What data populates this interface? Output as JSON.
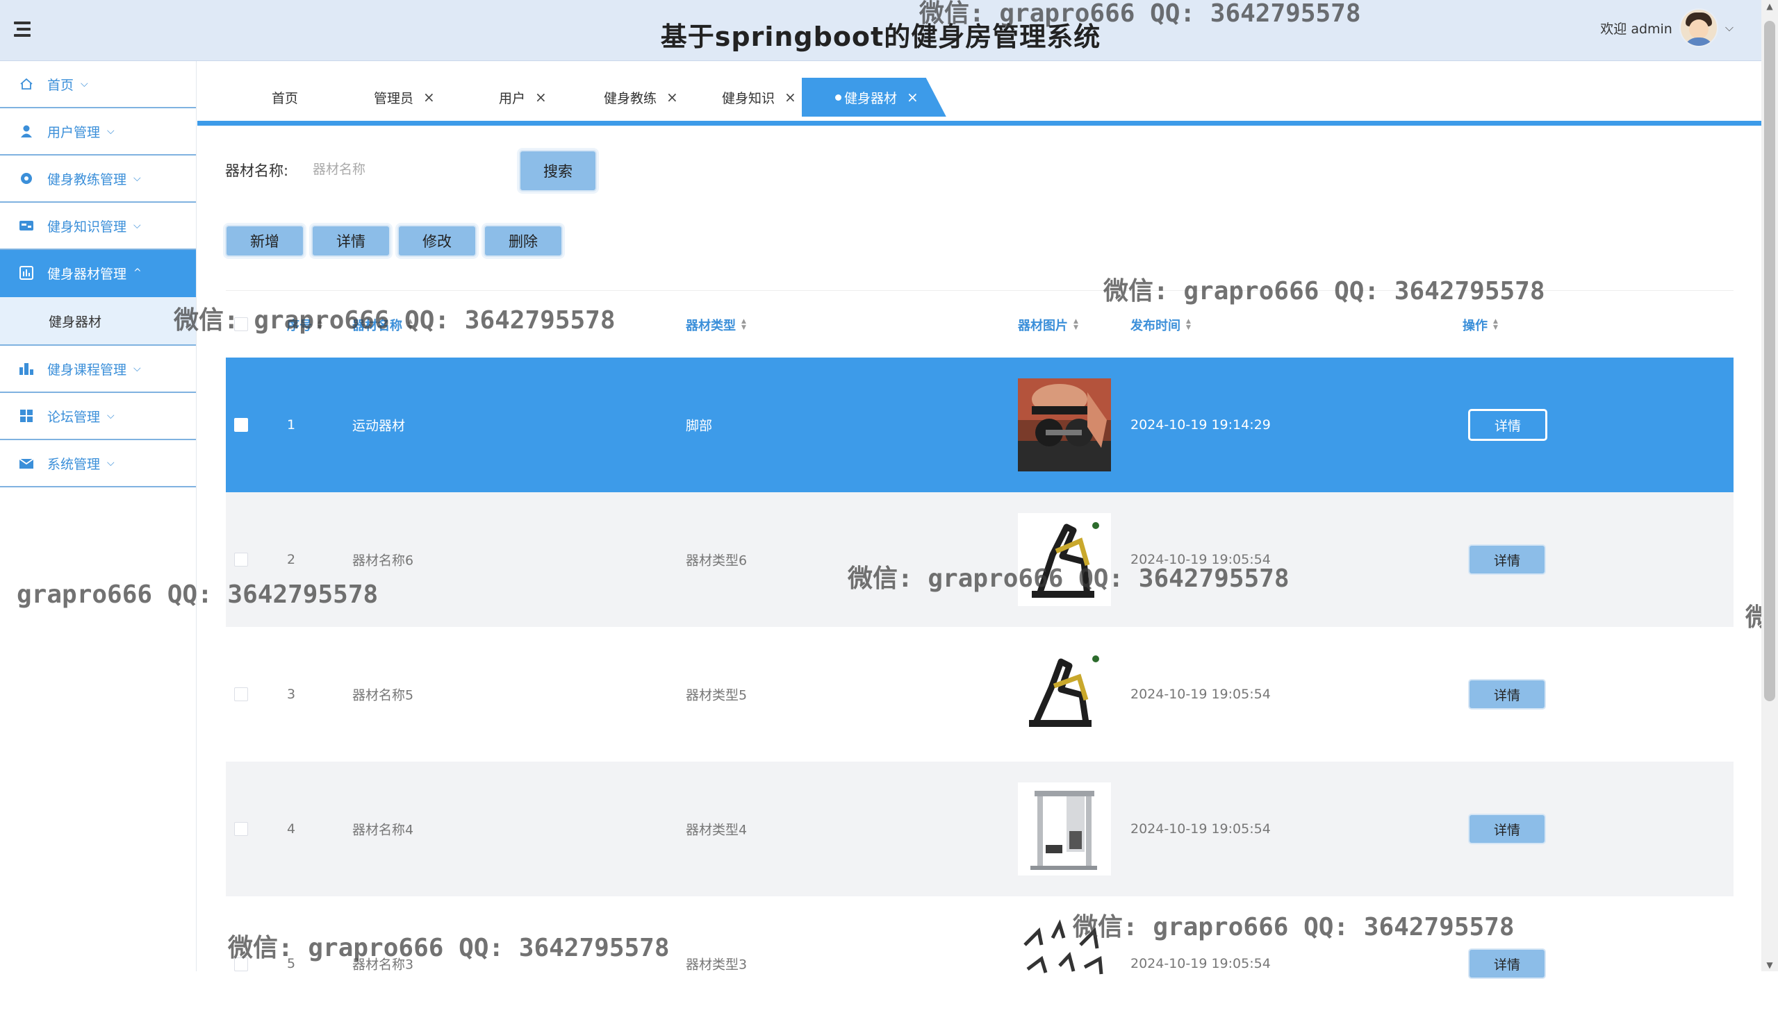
{
  "header": {
    "title": "基于springboot的健身房管理系统",
    "welcome": "欢迎 admin"
  },
  "sidebar": {
    "items": [
      {
        "label": "首页",
        "icon": "home-icon"
      },
      {
        "label": "用户管理",
        "icon": "user-icon"
      },
      {
        "label": "健身教练管理",
        "icon": "coach-icon"
      },
      {
        "label": "健身知识管理",
        "icon": "knowledge-icon"
      },
      {
        "label": "健身器材管理",
        "icon": "equipment-icon",
        "active": true
      },
      {
        "label": "健身课程管理",
        "icon": "course-icon"
      },
      {
        "label": "论坛管理",
        "icon": "forum-icon"
      },
      {
        "label": "系统管理",
        "icon": "system-icon"
      }
    ],
    "sub_item": "健身器材"
  },
  "tabs": [
    {
      "label": "首页"
    },
    {
      "label": "管理员"
    },
    {
      "label": "用户"
    },
    {
      "label": "健身教练"
    },
    {
      "label": "健身知识"
    },
    {
      "label": "健身器材",
      "active": true
    }
  ],
  "search": {
    "label": "器材名称:",
    "placeholder": "器材名称",
    "button": "搜索"
  },
  "actions": {
    "add": "新增",
    "detail": "详情",
    "edit": "修改",
    "delete": "删除"
  },
  "table": {
    "columns": [
      "序号",
      "器材名称",
      "器材类型",
      "器材图片",
      "发布时间",
      "操作"
    ],
    "rows": [
      {
        "index": "1",
        "name": "运动器材",
        "type": "脚部",
        "time": "2024-10-19 19:14:29",
        "action": "详情"
      },
      {
        "index": "2",
        "name": "器材名称6",
        "type": "器材类型6",
        "time": "2024-10-19 19:05:54",
        "action": "详情"
      },
      {
        "index": "3",
        "name": "器材名称5",
        "type": "器材类型5",
        "time": "2024-10-19 19:05:54",
        "action": "详情"
      },
      {
        "index": "4",
        "name": "器材名称4",
        "type": "器材类型4",
        "time": "2024-10-19 19:05:54",
        "action": "详情"
      },
      {
        "index": "5",
        "name": "器材名称3",
        "type": "器材类型3",
        "time": "2024-10-19 19:05:54",
        "action": "详情"
      }
    ]
  },
  "watermarks": [
    "微信: grapro666 QQ: 3642795578",
    "微信: grapro666 QQ: 3642795578",
    "微信: grapro666 QQ: 3642795578",
    "grapro666 QQ: 3642795578",
    "微信: grapro666 QQ: 3642795578",
    "微信: grapro666 QQ: 3642795578",
    "微信: grapro666 QQ: 3642795578",
    "微"
  ],
  "colors": {
    "primary": "#3d9be9",
    "header_bg": "#dfe9f6",
    "button_bg": "#8cbde8"
  }
}
